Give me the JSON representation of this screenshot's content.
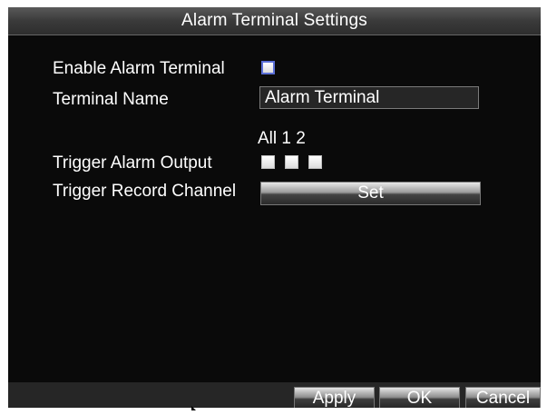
{
  "window": {
    "title": "Alarm Terminal Settings"
  },
  "form": {
    "enable_label": "Enable Alarm Terminal",
    "name_label": "Terminal Name",
    "name_value": "Alarm Terminal",
    "output_columns": "All 1  2",
    "output_label": "Trigger Alarm Output",
    "record_label": "Trigger Record Channel",
    "set_button": "Set"
  },
  "footer": {
    "apply": "Apply",
    "ok": "OK",
    "cancel": "Cancel"
  }
}
